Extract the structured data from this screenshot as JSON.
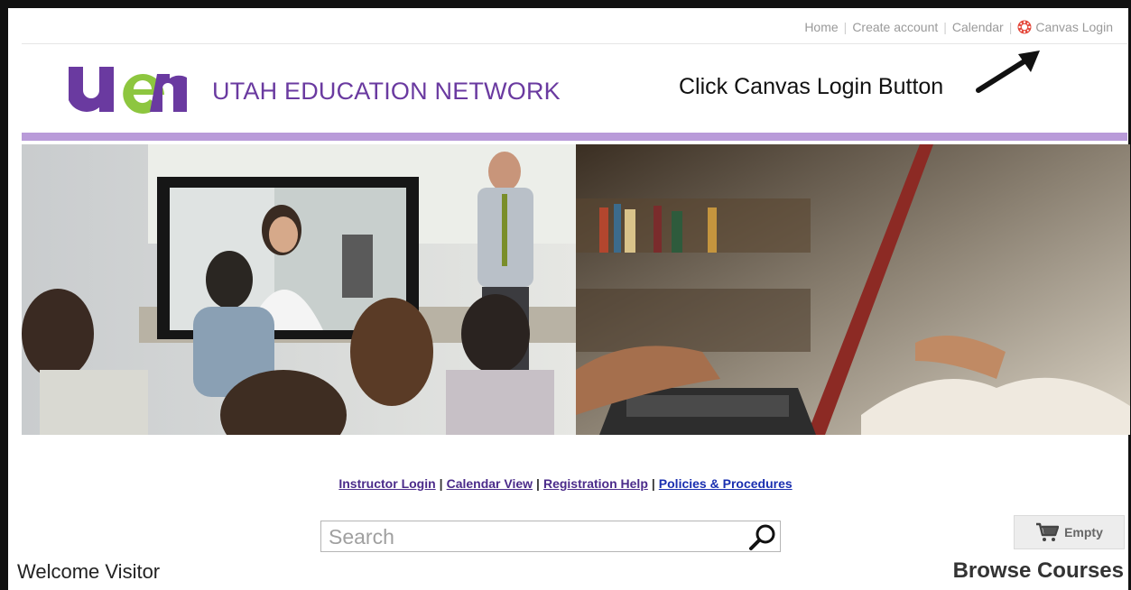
{
  "topnav": {
    "home": "Home",
    "create_account": "Create account",
    "calendar": "Calendar",
    "canvas_login": "Canvas Login",
    "canvas_icon": "canvas-logo-icon"
  },
  "header": {
    "logo_text": "uen",
    "org_name": "UTAH EDUCATION NETWORK",
    "annotation": "Click Canvas Login Button"
  },
  "links": {
    "instructor_login": "Instructor Login",
    "calendar_view": "Calendar View",
    "registration_help": "Registration Help",
    "policies": "Policies & Procedures",
    "separator": "|"
  },
  "search": {
    "placeholder": "Search",
    "icon": "search-icon"
  },
  "cart": {
    "label": "Empty",
    "icon": "shopping-cart-icon"
  },
  "welcome": "Welcome Visitor",
  "browse": "Browse Courses",
  "colors": {
    "brand_purple": "#6a3aa0",
    "brand_green": "#8dc63f",
    "bar_lavender": "#b99bd9",
    "link_purple": "#4b2b8a",
    "link_blue": "#1a2fb0"
  }
}
